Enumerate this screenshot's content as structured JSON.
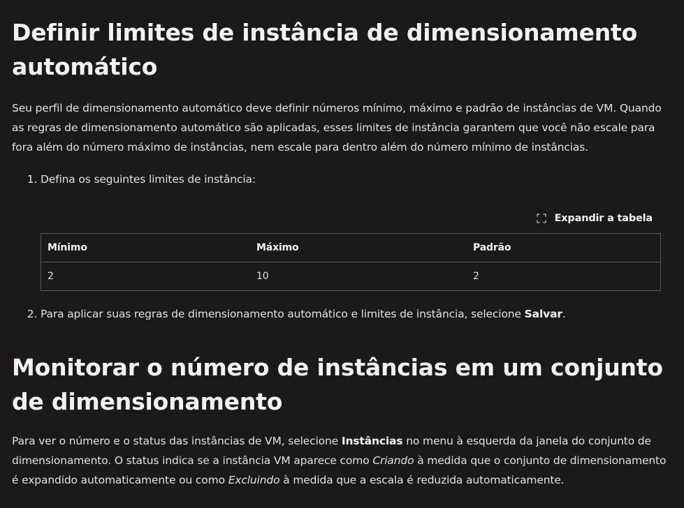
{
  "section1": {
    "title": "Definir limites de instância de dimensionamento automático",
    "intro": "Seu perfil de dimensionamento automático deve definir números mínimo, máximo e padrão de instâncias de VM. Quando as regras de dimensionamento automático são aplicadas, esses limites de instância garantem que você não escale para fora além do número máximo de instâncias, nem escale para dentro além do número mínimo de instâncias.",
    "step1_number": "1.",
    "step1_text": "Defina os seguintes limites de instância:",
    "expand_label": "Expandir a tabela",
    "expand_icon": "expand-icon",
    "table": {
      "headers": [
        "Mínimo",
        "Máximo",
        "Padrão"
      ],
      "rows": [
        [
          "2",
          "10",
          "2"
        ]
      ]
    },
    "step2_number": "2.",
    "step2_text_before": "Para aplicar suas regras de dimensionamento automático e limites de instância, selecione ",
    "step2_bold": "Salvar",
    "step2_text_after": "."
  },
  "section2": {
    "title": "Monitorar o número de instâncias em um conjunto de dimensionamento",
    "p_part1": "Para ver o número e o status das instâncias de VM, selecione ",
    "p_bold": "Instâncias",
    "p_part2": " no menu à esquerda da janela do conjunto de dimensionamento. O status indica se a instância VM aparece como ",
    "p_italic1": "Criando",
    "p_part3": " à medida que o conjunto de dimensionamento é expandido automaticamente ou como ",
    "p_italic2": "Excluindo",
    "p_part4": " à medida que a escala é reduzida automaticamente."
  }
}
